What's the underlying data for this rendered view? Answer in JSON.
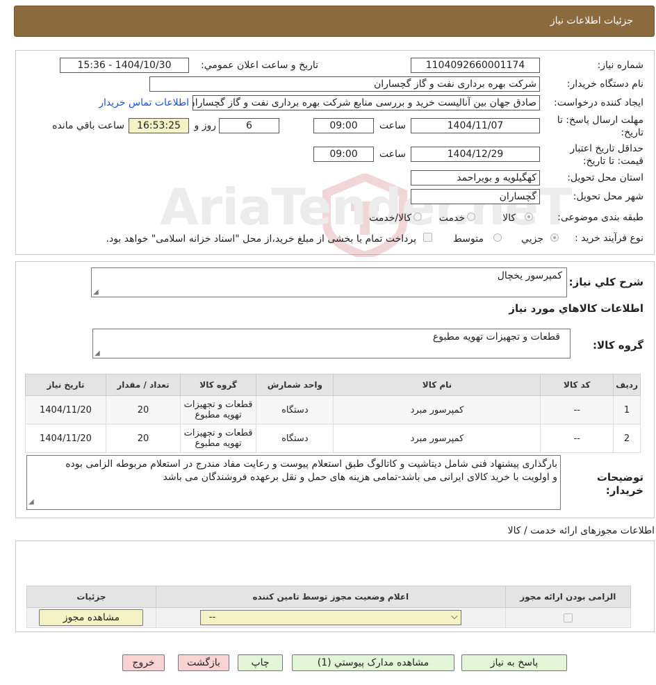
{
  "header": {
    "title": "جزئیات اطلاعات نیاز"
  },
  "fields": {
    "need_number_label": "شماره نیاز:",
    "need_number": "1104092660001174",
    "announce_label": "تاریخ و ساعت اعلان عمومي:",
    "announce_value": "1404/10/30 - 15:36",
    "buyer_org_label": "نام دستگاه خریدار:",
    "buyer_org": "شرکت بهره برداری نفت و گاز گچساران",
    "requester_label": "ایجاد کننده درخواست:",
    "requester": "صادق جهان بین آنالیست خرید و بررسی منابع شرکت بهره برداری نفت و گاز گچساران",
    "contact_link": "اطلاعات تماس خریدار",
    "deadline_label": "مهلت ارسال پاسخ: تا تاریخ:",
    "deadline_date": "1404/11/07",
    "hour_label": "ساعت",
    "deadline_time": "09:00",
    "days": "6",
    "days_label": "روز و",
    "remaining_time": "16:53:25",
    "remaining_label": "ساعت باقي مانده",
    "validity_label": "حداقل تاريخ اعتبار قيمت: تا تاريخ:",
    "validity_date": "1404/12/29",
    "validity_time": "09:00",
    "province_label": "استان محل تحویل:",
    "province": "کهگیلویه و بویراحمد",
    "city_label": "شهر محل تحویل:",
    "city": "گچساران",
    "category_label": "طبقه بندی موضوعی:",
    "category_options": [
      "کالا",
      "خدمت",
      "کالا/خدمت"
    ],
    "process_label": "نوع فرآیند خرید :",
    "process_options": [
      "جزیي",
      "متوسط"
    ],
    "payment_note": "پرداخت تمام یا بخشی از مبلغ خرید،از محل \"اسناد خزانه اسلامی\" خواهد بود."
  },
  "summary": {
    "label": "شرح کلي نياز:",
    "value": "کمپرسور یخچال",
    "items_title": "اطلاعات کالاهاي مورد نياز",
    "group_label": "گروه کالا:",
    "group_value": "قطعات و تجهیزات تهویه مطبوع"
  },
  "items_table": {
    "headers": [
      "رديف",
      "کد کالا",
      "نام کالا",
      "واحد شمارش",
      "گروه کالا",
      "تعداد / مقدار",
      "تاریخ نیاز"
    ],
    "rows": [
      [
        "1",
        "--",
        "کمپرسور مبرد",
        "دستگاه",
        "قطعات و تجهیزات تهویه مطبوع",
        "20",
        "1404/11/20"
      ],
      [
        "2",
        "--",
        "کمپرسور مبرد",
        "دستگاه",
        "قطعات و تجهیزات تهویه مطبوع",
        "20",
        "1404/11/20"
      ]
    ]
  },
  "notes": {
    "label": "توضیحات خریدار:",
    "line1": "بارگذاری پیشنهاد فنی شامل دیتاشیت و کاتالوگ طبق استعلام پیوست و رعایت مفاد مندرج در استعلام مربوطه الزامی بوده",
    "line2": "و اولویت با خرید کالای ایرانی می باشد-تمامی هزینه های حمل و نقل برعهده فروشندگان می باشد"
  },
  "permits": {
    "title": "اطلاعات مجوزهای ارائه خدمت / کالا",
    "headers": [
      "الزامی بودن ارائه مجوز",
      "اعلام وضعیت مجوز توسط تامین کننده",
      "جزئیات"
    ],
    "select_value": "--",
    "view_button": "مشاهده مجوز"
  },
  "buttons": {
    "reply": "پاسخ به نیاز",
    "attachments": "مشاهده مدارک پیوستي (1)",
    "print": "چاپ",
    "back": "بازگشت",
    "exit": "خروج"
  },
  "watermark": {
    "text": "AriaTender.neT"
  }
}
